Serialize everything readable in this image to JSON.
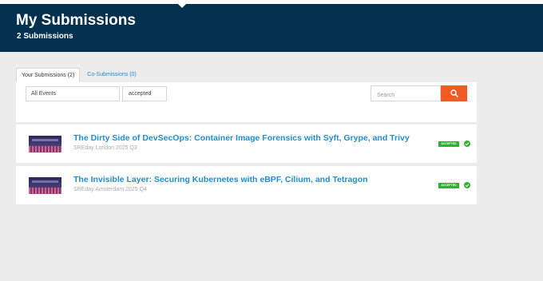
{
  "header": {
    "title": "My Submissions",
    "subtitle": "2 Submissions",
    "background": "#04304f"
  },
  "tabs": [
    {
      "label": "Your Submissions (2)",
      "active": true
    },
    {
      "label": "Co-Submissions (0)",
      "active": false
    }
  ],
  "filters": {
    "event_value": "All Events",
    "status_value": "accepted",
    "search_placeholder": "Search",
    "search_icon": "search-icon",
    "search_color": "#f05b25"
  },
  "submissions": [
    {
      "title": "The Dirty Side of DevSecOps: Container Image Forensics with Syft, Grype, and Trivy",
      "event": "SREday London 2025 Q3",
      "status": "ACCEPTED",
      "status_icon": "check-circle-icon"
    },
    {
      "title": "The Invisible Layer: Securing Kubernetes with eBPF, Cilium, and Tetragon",
      "event": "SREday Amsterdam 2025 Q4",
      "status": "ACCEPTED",
      "status_icon": "check-circle-icon"
    }
  ],
  "colors": {
    "link": "#1f8ecf",
    "accepted": "#2fb133",
    "page_bg": "#ececec"
  }
}
